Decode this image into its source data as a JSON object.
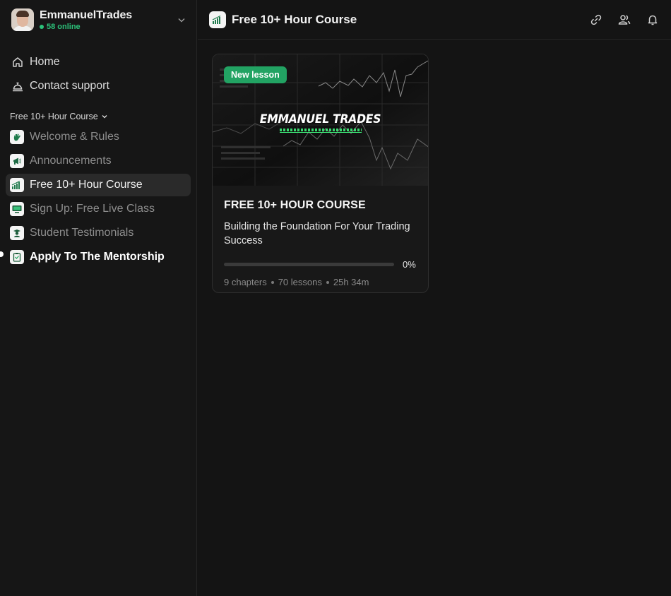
{
  "workspace": {
    "name": "EmmanuelTrades",
    "online": "58 online"
  },
  "nav": {
    "home": "Home",
    "support": "Contact support"
  },
  "section": {
    "label": "Free 10+ Hour Course"
  },
  "channels": [
    {
      "label": "Welcome & Rules",
      "icon": "wave-hand-icon",
      "state": "read"
    },
    {
      "label": "Announcements",
      "icon": "megaphone-icon",
      "state": "read"
    },
    {
      "label": "Free 10+ Hour Course",
      "icon": "chart-bars-icon",
      "state": "active"
    },
    {
      "label": "Sign Up: Free Live Class",
      "icon": "monitor-icon",
      "state": "read"
    },
    {
      "label": "Student Testimonials",
      "icon": "graduate-icon",
      "state": "read"
    },
    {
      "label": "Apply To The Mentorship",
      "icon": "clipboard-icon",
      "state": "unread"
    }
  ],
  "topbar": {
    "title": "Free 10+ Hour Course",
    "actions": [
      "link-icon",
      "members-icon",
      "bell-icon"
    ]
  },
  "course": {
    "badge": "New lesson",
    "thumbnail_brand": "EMMANUEL TRADES",
    "title": "FREE 10+ HOUR COURSE",
    "description": "Building the Foundation For Your Trading Success",
    "progress_label": "0%",
    "progress_fraction": 0,
    "chapters": "9 chapters",
    "lessons": "70 lessons",
    "duration": "25h 34m"
  },
  "colors": {
    "accent": "#22a363",
    "online": "#2cc27a",
    "background": "#141414"
  }
}
